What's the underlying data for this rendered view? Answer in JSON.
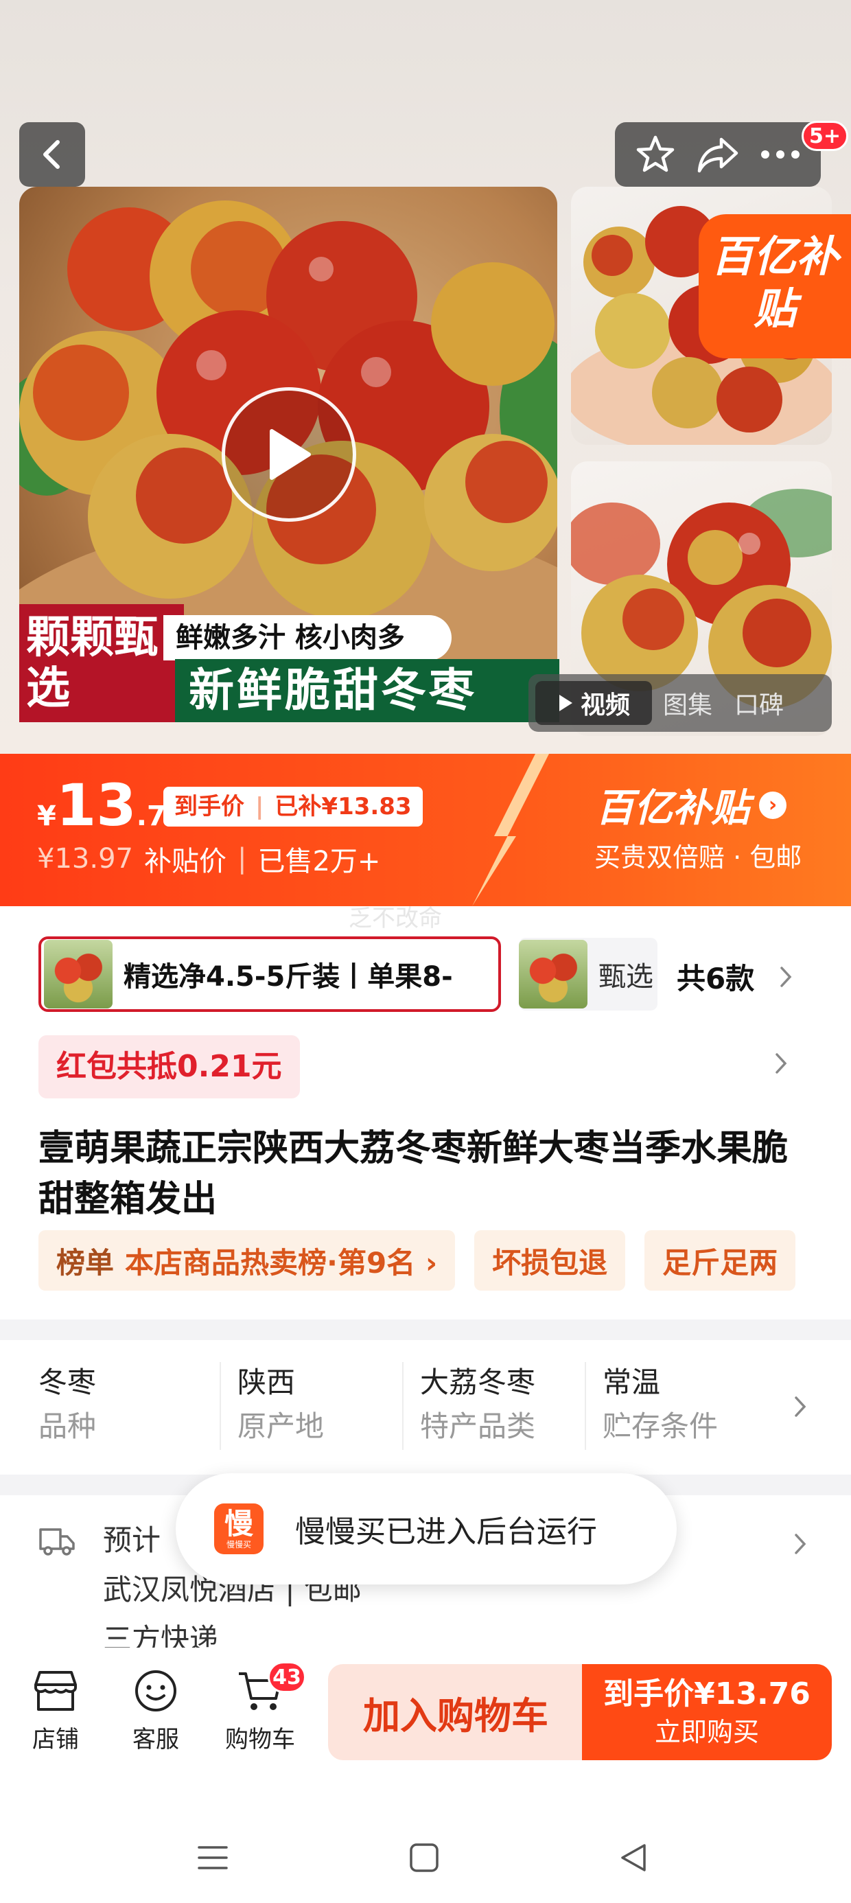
{
  "header": {
    "more_badge": "5+"
  },
  "hero": {
    "banner_left": "颗颗甄选",
    "banner_slogan": "鲜嫩多汁 核小肉多",
    "banner_product": "新鲜脆甜冬枣",
    "subsidy_tag": "百亿补贴",
    "media_tabs": [
      {
        "label": "视频",
        "active": true
      },
      {
        "label": "图集",
        "active": false
      },
      {
        "label": "口碑",
        "active": false
      }
    ]
  },
  "price": {
    "currency": "¥",
    "integer": "13",
    "decimal": ".76",
    "pill_label": "到手价",
    "pill_subsidy": "已补¥13.83",
    "original": "¥13.97",
    "original_label": "补贴价",
    "sold": "已售2万+",
    "brand": "百亿补贴",
    "brand_sub": "买贵双倍赔 · 包邮",
    "accent_color": "#ff4a14"
  },
  "watermark": "乏不改命",
  "sku": {
    "selected": "精选净4.5-5斤装丨单果8-",
    "second": "甄选",
    "count": "共6款"
  },
  "coupon": "红包共抵0.21元",
  "title": "壹萌果蔬正宗陕西大荔冬枣新鲜大枣当季水果脆甜整箱发出",
  "tags": [
    {
      "k": "榜单",
      "v": "本店商品热卖榜·第9名 ›"
    },
    {
      "k": "坏损包退"
    },
    {
      "k": "足斤足两"
    }
  ],
  "attributes": [
    {
      "value": "冬枣",
      "key": "品种"
    },
    {
      "value": "陕西",
      "key": "原产地"
    },
    {
      "value": "大荔冬枣",
      "key": "特产品类"
    },
    {
      "value": "常温",
      "key": "贮存条件"
    }
  ],
  "delivery": {
    "line1": "预计",
    "line2": "武汉凤悦酒店 | 包邮",
    "line3": "三方快递"
  },
  "toast": {
    "logo_main": "慢",
    "logo_sub": "慢慢买",
    "text": "慢慢买已进入后台运行"
  },
  "bottom": {
    "shop": "店铺",
    "service": "客服",
    "cart": "购物车",
    "cart_count": "43",
    "add_cart": "加入购物车",
    "buy_line1": "到手价¥13.76",
    "buy_line2": "立即购买"
  }
}
